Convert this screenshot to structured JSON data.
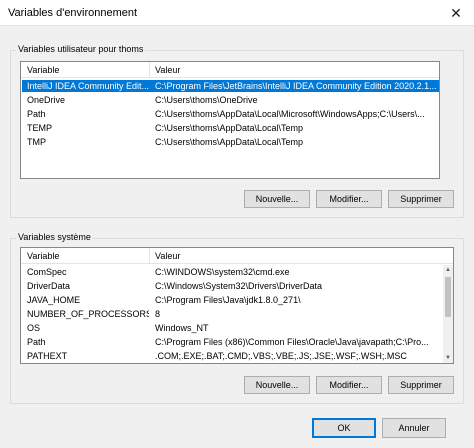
{
  "window": {
    "title": "Variables d'environnement",
    "close_glyph": "✕"
  },
  "user_group": {
    "label": "Variables utilisateur pour thoms",
    "columns": [
      "Variable",
      "Valeur"
    ],
    "rows": [
      {
        "variable": "IntelliJ IDEA Community Edit...",
        "value": "C:\\Program Files\\JetBrains\\IntelliJ IDEA Community Edition 2020.2.1...",
        "selected": true
      },
      {
        "variable": "OneDrive",
        "value": "C:\\Users\\thoms\\OneDrive"
      },
      {
        "variable": "Path",
        "value": "C:\\Users\\thoms\\AppData\\Local\\Microsoft\\WindowsApps;C:\\Users\\..."
      },
      {
        "variable": "TEMP",
        "value": "C:\\Users\\thoms\\AppData\\Local\\Temp"
      },
      {
        "variable": "TMP",
        "value": "C:\\Users\\thoms\\AppData\\Local\\Temp"
      }
    ],
    "buttons": {
      "new": "Nouvelle...",
      "edit": "Modifier...",
      "delete": "Supprimer"
    }
  },
  "system_group": {
    "label": "Variables système",
    "columns": [
      "Variable",
      "Valeur"
    ],
    "rows": [
      {
        "variable": "ComSpec",
        "value": "C:\\WINDOWS\\system32\\cmd.exe"
      },
      {
        "variable": "DriverData",
        "value": "C:\\Windows\\System32\\Drivers\\DriverData"
      },
      {
        "variable": "JAVA_HOME",
        "value": "C:\\Program Files\\Java\\jdk1.8.0_271\\"
      },
      {
        "variable": "NUMBER_OF_PROCESSORS",
        "value": "8"
      },
      {
        "variable": "OS",
        "value": "Windows_NT"
      },
      {
        "variable": "Path",
        "value": "C:\\Program Files (x86)\\Common Files\\Oracle\\Java\\javapath;C:\\Pro..."
      },
      {
        "variable": "PATHEXT",
        "value": ".COM;.EXE;.BAT;.CMD;.VBS;.VBE;.JS;.JSE;.WSF;.WSH;.MSC"
      }
    ],
    "buttons": {
      "new": "Nouvelle...",
      "edit": "Modifier...",
      "delete": "Supprimer"
    },
    "scroll": {
      "up_glyph": "▲",
      "down_glyph": "▼"
    }
  },
  "footer": {
    "ok": "OK",
    "cancel": "Annuler"
  },
  "colors": {
    "selection": "#0078d7",
    "border": "#828790",
    "button_face": "#e1e1e1"
  }
}
